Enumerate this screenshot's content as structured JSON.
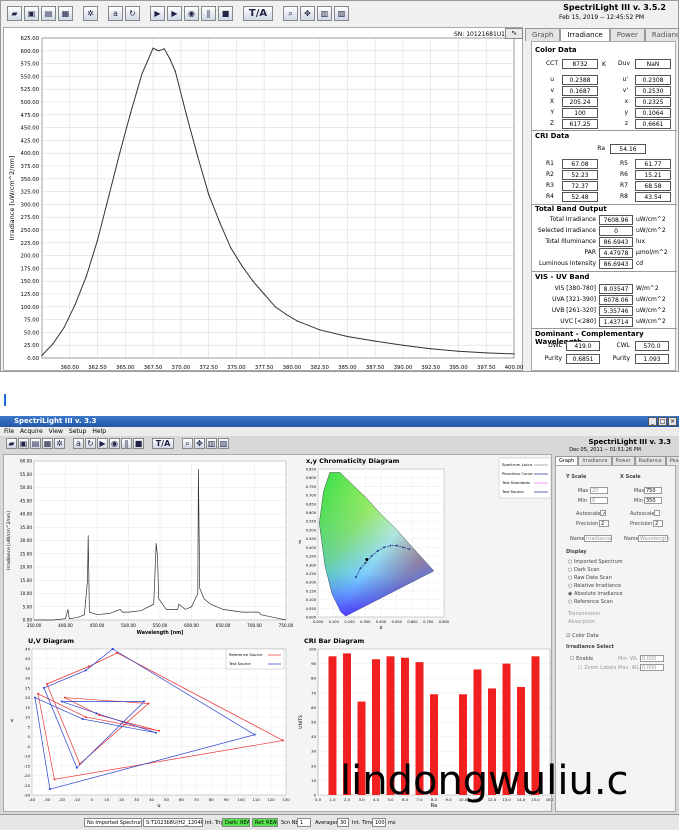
{
  "top": {
    "title": "SpectriLight III v. 3.5.2",
    "datetime": "Feb 15, 2019 -- 12:45:52 PM",
    "serial": "SN: 10121681U1",
    "tabs": [
      "Graph",
      "Irradiance",
      "Power",
      "Radiance",
      "R"
    ],
    "active_tab": "Irradiance",
    "toolbar": {
      "ta": "T/A"
    },
    "chart_data": {
      "type": "line",
      "ylabel": "Irradiance [uW/cm^2/nm]",
      "xlabel": "",
      "xlim": [
        357.5,
        400.0
      ],
      "ylim": [
        0,
        625
      ],
      "x_ticks": [
        "360.00",
        "362.50",
        "365.00",
        "367.50",
        "370.00",
        "372.50",
        "375.00",
        "377.50",
        "380.00",
        "382.50",
        "385.00",
        "387.50",
        "390.00",
        "392.50",
        "395.00",
        "397.50",
        "400.00"
      ],
      "y_ticks": [
        "0.00",
        "25.00",
        "50.00",
        "75.00",
        "100.00",
        "125.00",
        "150.00",
        "175.00",
        "200.00",
        "225.00",
        "250.00",
        "275.00",
        "300.00",
        "325.00",
        "350.00",
        "375.00",
        "400.00",
        "425.00",
        "450.00",
        "475.00",
        "500.00",
        "525.00",
        "550.00",
        "575.00",
        "600.00",
        "625.00"
      ],
      "x": [
        357.5,
        358.5,
        359.5,
        360.5,
        361.5,
        362.5,
        363.5,
        364.5,
        365.5,
        366.5,
        367.5,
        368.0,
        368.5,
        369.0,
        369.5,
        370.5,
        371.5,
        372.5,
        373.5,
        374.5,
        375.5,
        376.5,
        377.5,
        378.5,
        379.5,
        380.5,
        382.5,
        385.0,
        387.5,
        390.0,
        392.5,
        395.0,
        397.5,
        400.0
      ],
      "y": [
        5,
        28,
        60,
        105,
        160,
        230,
        315,
        400,
        480,
        555,
        605,
        600,
        604,
        585,
        560,
        475,
        395,
        320,
        265,
        215,
        180,
        150,
        125,
        100,
        85,
        72,
        55,
        42,
        33,
        25,
        18,
        13,
        10,
        8
      ]
    },
    "color": {
      "title": "Color Data",
      "cct_label": "CCT",
      "cct": "8732",
      "cct_unit": "K",
      "duv_label": "Duv",
      "duv": "NaN",
      "rows": [
        [
          "u",
          "0.2388",
          "u'",
          "0.2308"
        ],
        [
          "v",
          "0.1687",
          "v'",
          "0.2530"
        ],
        [
          "X",
          "205.24",
          "x",
          "0.2325"
        ],
        [
          "Y",
          "100",
          "y",
          "0.1064"
        ],
        [
          "Z",
          "617.25",
          "z",
          "0.6661"
        ]
      ]
    },
    "cri": {
      "title": "CRI Data",
      "ra_label": "Ra",
      "ra": "54.16",
      "rows": [
        [
          "R1",
          "67.08",
          "R5",
          "61.77"
        ],
        [
          "R2",
          "52.23",
          "R6",
          "15.21"
        ],
        [
          "R3",
          "72.37",
          "R7",
          "68.58"
        ],
        [
          "R4",
          "52.48",
          "R8",
          "43.54"
        ]
      ]
    },
    "band": {
      "title": "Total Band Output",
      "rows": [
        [
          "Total Irradiance",
          "7608.96",
          "uW/cm^2"
        ],
        [
          "Selected Irradiance",
          "0",
          "uW/cm^2"
        ],
        [
          "Total Illuminance",
          "86.6943",
          "lux"
        ],
        [
          "PAR",
          "4.47978",
          "µmol/m^2"
        ],
        [
          "Luminous Intensity",
          "86.6943",
          "cd"
        ]
      ]
    },
    "vis": {
      "title": "VIS - UV Band",
      "rows": [
        [
          "VIS [380-780]",
          "8.03547",
          "W/m^2"
        ],
        [
          "UVA [321-390]",
          "6078.06",
          "uW/cm^2"
        ],
        [
          "UVB [261-320]",
          "5.35746",
          "uW/cm^2"
        ],
        [
          "UVC [<280]",
          "1.43714",
          "uW/cm^2"
        ]
      ]
    },
    "dom": {
      "title": "Dominant - Complementary Wavelength",
      "dwl_label": "DWL",
      "dwl": "419.0",
      "cwl_label": "CWL",
      "cwl": "570.0",
      "p1_label": "Purity",
      "p1": "0.6851",
      "p2_label": "Purity",
      "p2": "1.093"
    }
  },
  "bottom": {
    "title": "SpectriLight III v. 3.3",
    "app_title": "SpectriLight III v. 3.3",
    "datetime": "Dec 05, 2011 -- 01:51:26 PM",
    "menu": [
      "File",
      "Acquire",
      "View",
      "Setup",
      "Help"
    ],
    "toolbar": {
      "ta": "T/A"
    },
    "tabs": [
      "Graph",
      "Irradiance",
      "Power",
      "Radiance",
      "Peak"
    ],
    "active_tab": "Graph",
    "spectrum": {
      "ylabel": "Irradiance [uW/cm^2/nm]",
      "xlabel": "Wavelength [nm]",
      "y_ticks": [
        "0.00",
        "5.00",
        "10.00",
        "15.00",
        "20.00",
        "25.00",
        "30.00",
        "35.00",
        "40.00",
        "45.00",
        "50.00",
        "55.00",
        "60.00"
      ],
      "x_ticks": [
        "350.00",
        "400.00",
        "450.00",
        "500.00",
        "550.00",
        "600.00",
        "650.00",
        "700.00",
        "750.00"
      ],
      "chart_data": {
        "type": "line",
        "xlim": [
          350,
          750
        ],
        "ylim": [
          0,
          60
        ],
        "x": [
          350,
          380,
          400,
          404,
          406,
          420,
          430,
          435,
          436,
          438,
          450,
          470,
          487,
          490,
          500,
          520,
          540,
          544,
          546,
          548,
          560,
          578,
          580,
          590,
          600,
          610,
          611,
          613,
          620,
          630,
          650,
          680,
          707,
          710,
          730,
          750
        ],
        "y": [
          0,
          0,
          0.5,
          4,
          0.5,
          1,
          2,
          15,
          32,
          3,
          2,
          2.5,
          4,
          3,
          3,
          3.5,
          6,
          29,
          24,
          8,
          4,
          4,
          6,
          4,
          5,
          10,
          57,
          12,
          8,
          6,
          4,
          3,
          3,
          2,
          1,
          0
        ]
      }
    },
    "chroma": {
      "title": "x,y Chromaticity Diagram",
      "xlabel": "x",
      "ylabel": "y",
      "x_ticks": [
        "0.000",
        "0.050",
        "0.100",
        "0.150",
        "0.200",
        "0.250",
        "0.300",
        "0.350",
        "0.400",
        "0.450",
        "0.500",
        "0.550",
        "0.600",
        "0.650",
        "0.700",
        "0.750",
        "0.800"
      ],
      "y_ticks": [
        "0.000",
        "0.050",
        "0.100",
        "0.150",
        "0.200",
        "0.250",
        "0.300",
        "0.350",
        "0.400",
        "0.450",
        "0.500",
        "0.550",
        "0.600",
        "0.650",
        "0.700",
        "0.750",
        "0.800",
        "0.850"
      ],
      "legend": [
        "Spectrum Locus",
        "Planckian Curve",
        "Test Standards",
        "Test Source"
      ]
    },
    "uv": {
      "title": "U,V Diagram",
      "xlabel": "u",
      "ylabel": "v",
      "legend": [
        "Reference Source",
        "Test Source"
      ],
      "x_ticks": [
        "-40",
        "-30",
        "-20",
        "-10",
        "0",
        "10",
        "20",
        "30",
        "40",
        "50",
        "60",
        "70",
        "80",
        "90",
        "100",
        "110",
        "120",
        "130"
      ],
      "y_ticks": [
        "-30",
        "-25",
        "-20",
        "-15",
        "-10",
        "-5",
        "0",
        "5",
        "10",
        "15",
        "20",
        "25",
        "30",
        "35",
        "40",
        "45"
      ]
    },
    "cri_bar": {
      "title": "CRI Bar Diagram",
      "xlabel": "Ra",
      "ylabel": "UNITS",
      "chart_data": {
        "type": "bar",
        "categories": [
          "1",
          "2",
          "3",
          "4",
          "5",
          "6",
          "7",
          "8",
          "9",
          "10",
          "11",
          "12",
          "13",
          "14",
          "15"
        ],
        "values": [
          95,
          97,
          64,
          93,
          95,
          94,
          91,
          69,
          0,
          69,
          86,
          73,
          90,
          74,
          95
        ],
        "ylim": [
          0,
          100
        ],
        "y_ticks": [
          "0",
          "10",
          "20",
          "30",
          "40",
          "50",
          "60",
          "70",
          "80",
          "90",
          "100"
        ],
        "x_ticks": [
          "0.0",
          "1.0",
          "2.0",
          "3.0",
          "4.0",
          "5.0",
          "6.0",
          "7.0",
          "8.0",
          "9.0",
          "10.0",
          "11.0",
          "12.0",
          "13.0",
          "14.0",
          "15.0",
          "16.0"
        ]
      }
    },
    "side": {
      "yscale": "Y Scale",
      "xscale": "X Scale",
      "max": "Max",
      "min": "Min",
      "autoscale": "Autoscale",
      "precision": "Precision",
      "name": "Name",
      "ymax": "20",
      "ymin": "0",
      "yprec": "2",
      "yname": "Irradiance",
      "xmax": "750",
      "xmin": "350",
      "xprec": "2",
      "xname": "Wavelength",
      "display": "Display",
      "options": [
        "Imported Spectrum",
        "Dark Scan",
        "Raw Data Scan",
        "Relative Irradiance",
        "Absolute Irradiance",
        "Reference Scan"
      ],
      "selected": "Absolute Irradiance",
      "extra": [
        "Transmission",
        "Absorption"
      ],
      "color_data": "Color Data",
      "irr_select": "Irradiance Select",
      "enable": "Enable",
      "zoom": "Zoom Labels",
      "min_wl": "Min. WL",
      "max_wl": "Max. WL",
      "min_val": "0.000",
      "max_val": "0.000"
    },
    "status": {
      "file": "No Imported Spectrum",
      "path": "S:T1023b8U/H2_12046.csv",
      "int_trig": "Int. Trig",
      "dark": "Dark: READY",
      "ref": "Ref: READY",
      "scan_nbr_label": "Scn Nbr",
      "scan_nbr": "1",
      "avg_label": "Averages",
      "avg": "30",
      "int_time_label": "Int. Time",
      "int_time": "100",
      "ms": "ms"
    }
  },
  "watermark": "lindongwuliu.c"
}
